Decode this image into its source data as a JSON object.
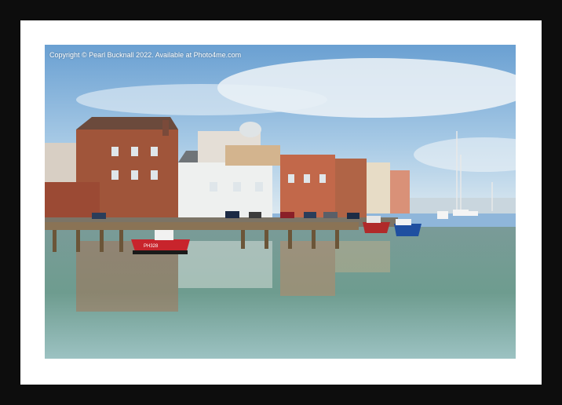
{
  "watermark": {
    "text": "Copyright © Pearl Bucknall 2022. Available at Photo4me.com"
  },
  "boat_label": "PH328",
  "colors": {
    "frame": "#0d0d0d",
    "mount": "#ffffff",
    "sky": "#8fb6da",
    "water": "#6f9a90",
    "brick": "#a0553a"
  }
}
